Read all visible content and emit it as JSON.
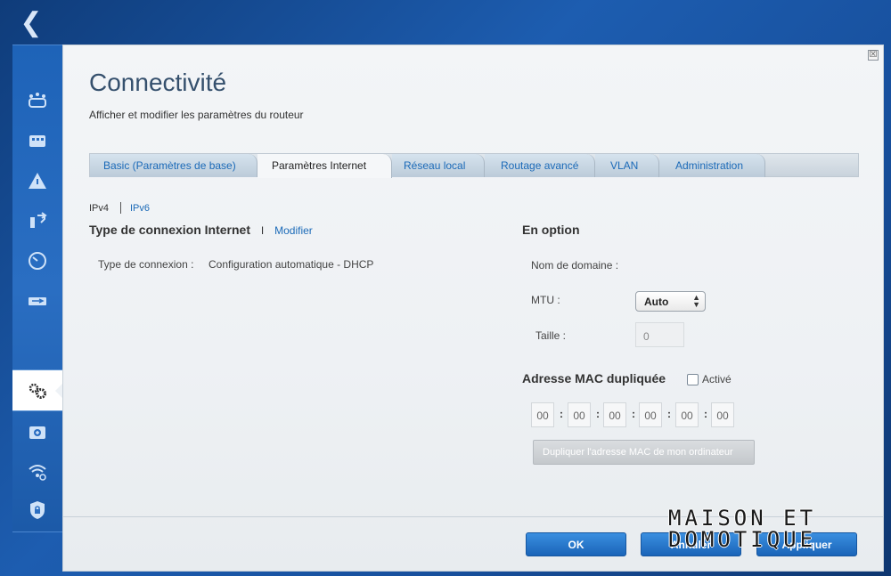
{
  "window": {
    "back_icon": "chevron-left-icon",
    "close_label": "☒"
  },
  "sidebar": {
    "items": [
      {
        "icon": "network-map-icon"
      },
      {
        "icon": "device-list-icon"
      },
      {
        "icon": "parental-controls-icon"
      },
      {
        "icon": "media-prioritization-icon"
      },
      {
        "icon": "speed-test-icon"
      },
      {
        "icon": "external-storage-icon"
      },
      {
        "icon": "connectivity-gear-icon",
        "active": true
      },
      {
        "icon": "troubleshooting-icon"
      },
      {
        "icon": "wireless-icon"
      },
      {
        "icon": "security-icon"
      }
    ]
  },
  "page": {
    "title": "Connectivité",
    "subtitle": "Afficher et modifier les paramètres du routeur"
  },
  "tabs": [
    {
      "label": "Basic (Paramètres de base)",
      "active": false
    },
    {
      "label": "Paramètres Internet",
      "active": true
    },
    {
      "label": "Réseau local",
      "active": false
    },
    {
      "label": "Routage avancé",
      "active": false
    },
    {
      "label": "VLAN",
      "active": false
    },
    {
      "label": "Administration",
      "active": false
    }
  ],
  "ip_toggle": {
    "ipv4": "IPv4",
    "ipv6": "IPv6"
  },
  "connection": {
    "heading": "Type de connexion Internet",
    "separator": "I",
    "edit_link": "Modifier",
    "type_label": "Type de connexion :",
    "type_value": "Configuration automatique - DHCP"
  },
  "optional": {
    "heading": "En option",
    "domain_label": "Nom de domaine :",
    "mtu_label": "MTU :",
    "mtu_value": "Auto",
    "size_label": "Taille :",
    "size_value": "0"
  },
  "mac_clone": {
    "heading": "Adresse MAC dupliquée",
    "enabled_label": "Activé",
    "enabled": false,
    "octets": [
      "00",
      "00",
      "00",
      "00",
      "00",
      "00"
    ],
    "separator": ":",
    "clone_button": "Dupliquer l'adresse MAC de mon ordinateur"
  },
  "footer": {
    "ok_label": "OK",
    "cancel_label": "Annuler",
    "apply_label": "Appliquer"
  },
  "watermark": {
    "line1": "MAISON ET",
    "line2": "DOMOTIQUE"
  },
  "colors": {
    "accent": "#1b6ab8",
    "background": "#1d5db0"
  }
}
